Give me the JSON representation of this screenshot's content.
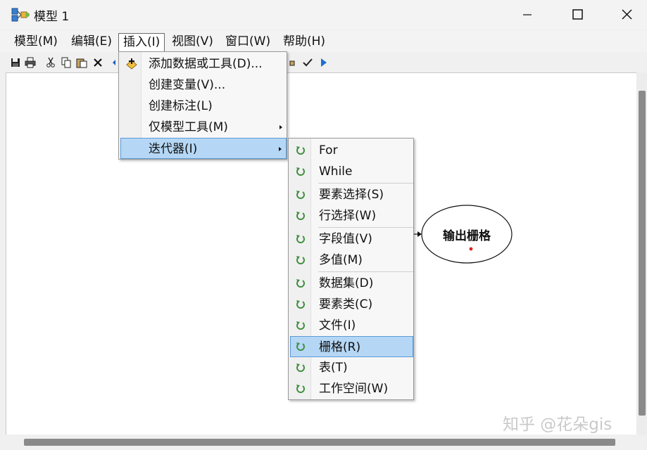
{
  "window": {
    "title": "模型 1",
    "app_icon": "model-icon",
    "controls": [
      "minimize-icon",
      "maximize-icon",
      "close-icon"
    ]
  },
  "menubar": {
    "items": [
      "模型(M)",
      "编辑(E)",
      "插入(I)",
      "视图(V)",
      "窗口(W)",
      "帮助(H)"
    ],
    "open_item": "插入(I)"
  },
  "toolbar": {
    "icons": [
      "save-icon",
      "print-icon",
      "cut-icon",
      "copy-icon",
      "paste-icon",
      "delete-icon",
      "undo-icon",
      "validate-icon",
      "run-icon"
    ]
  },
  "insert_menu": {
    "items": [
      {
        "label": "添加数据或工具(D)...",
        "icon": "add-data-icon"
      },
      {
        "label": "创建变量(V)..."
      },
      {
        "label": "创建标注(L)"
      },
      {
        "label": "仅模型工具(M)",
        "submenu": true
      },
      {
        "label": "迭代器(I)",
        "submenu": true,
        "highlighted": true
      }
    ]
  },
  "iterator_menu": {
    "items": [
      {
        "label": "For"
      },
      {
        "label": "While"
      },
      {
        "label": "要素选择(S)"
      },
      {
        "label": "行选择(W)"
      },
      {
        "label": "字段值(V)"
      },
      {
        "label": "多值(M)"
      },
      {
        "label": "数据集(D)"
      },
      {
        "label": "要素类(C)"
      },
      {
        "label": "文件(I)"
      },
      {
        "label": "栅格(R)",
        "highlighted": true
      },
      {
        "label": "表(T)"
      },
      {
        "label": "工作空间(W)"
      }
    ],
    "icon": "iterator-icon",
    "icon_color": "#3f8f3f"
  },
  "model_canvas": {
    "output_node": {
      "label": "输出栅格"
    }
  },
  "watermark": "知乎 @花朵gis",
  "colors": {
    "highlight": "#b5d7f5",
    "highlight_border": "#5c9ad6"
  }
}
